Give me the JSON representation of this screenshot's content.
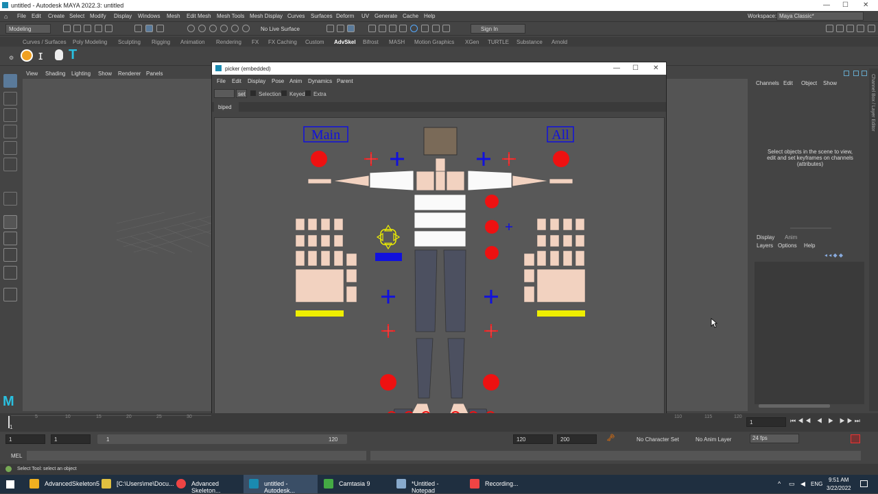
{
  "window": {
    "title": "untitled - Autodesk MAYA 2022.3: untitled"
  },
  "menubar": [
    "File",
    "Edit",
    "Create",
    "Select",
    "Modify",
    "Display",
    "Windows",
    "Mesh",
    "Edit Mesh",
    "Mesh Tools",
    "Mesh Display",
    "Curves",
    "Surfaces",
    "Deform",
    "UV",
    "Generate",
    "Cache",
    "Help"
  ],
  "workspace": {
    "label": "Workspace:",
    "value": "Maya Classic*"
  },
  "toolbar": {
    "mode": "Modeling",
    "live_surface": "No Live Surface",
    "signin": "Sign In"
  },
  "shelf_tabs": [
    "Curves / Surfaces",
    "Poly Modeling",
    "Sculpting",
    "Rigging",
    "Animation",
    "Rendering",
    "FX",
    "FX Caching",
    "Custom",
    "AdvSkel",
    "Bifrost",
    "MASH",
    "Motion Graphics",
    "XGen",
    "TURTLE",
    "Substance",
    "Arnold"
  ],
  "shelf_active": "AdvSkel",
  "viewport_menu": [
    "View",
    "Shading",
    "Lighting",
    "Show",
    "Renderer",
    "Panels"
  ],
  "picker": {
    "title": "picker (embedded)",
    "menu": [
      "File",
      "Edit",
      "Display",
      "Pose",
      "Anim",
      "Dynamics",
      "Parent"
    ],
    "set_button": "set",
    "checks": [
      "Selection",
      "Keyed",
      "Extra"
    ],
    "tab": "biped",
    "main_label": "Main",
    "all_label": "All"
  },
  "channel_box": {
    "menu": [
      "Channels",
      "Edit",
      "Object",
      "Show"
    ],
    "message": "Select objects in the scene to view, edit and set keyframes on channels (attributes)",
    "side_label": "Channel Box / Layer Editor",
    "layer_tabs": [
      "Display",
      "Anim"
    ],
    "layer_menu": [
      "Layers",
      "Options",
      "Help"
    ]
  },
  "timeline": {
    "ticks": [
      "1",
      "5",
      "10",
      "15",
      "20",
      "25",
      "30"
    ],
    "right_ticks": [
      "110",
      "115",
      "120"
    ],
    "current_frame": "1"
  },
  "range": {
    "start": "1",
    "inner_start": "1",
    "slider_start": "1",
    "slider_end": "120",
    "end": "120",
    "max": "200",
    "character_set": "No Character Set",
    "anim_layer": "No Anim Layer",
    "fps": "24 fps"
  },
  "mel": {
    "label": "MEL"
  },
  "helpline": {
    "text": "Select Tool: select an object"
  },
  "taskbar": {
    "items": [
      "AdvancedSkeleton5",
      "[C:\\Users\\me\\Docu...",
      "Advanced Skeleton...",
      "untitled - Autodesk...",
      "Camtasia 9",
      "*Untitled - Notepad",
      "Recording..."
    ],
    "lang": "ENG",
    "time": "9:51 AM",
    "date": "3/22/2022"
  },
  "colors": {
    "accent_red": "#ee1111",
    "accent_blue": "#1111dd",
    "skin": "#f2d2c0",
    "limb": "#4c5060",
    "yellow": "#eeee00",
    "head": "#7a6a58"
  }
}
